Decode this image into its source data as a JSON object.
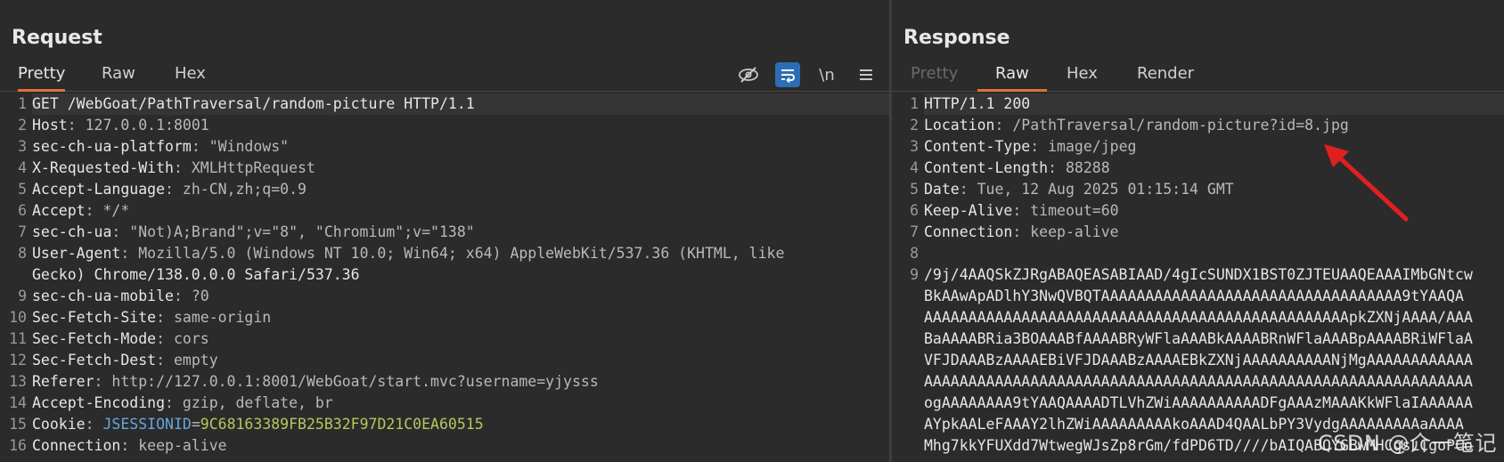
{
  "request": {
    "title": "Request",
    "tabs": [
      {
        "label": "Pretty",
        "active": true
      },
      {
        "label": "Raw",
        "active": false
      },
      {
        "label": "Hex",
        "active": false
      }
    ],
    "tools": [
      {
        "icon": "eye-off-icon"
      },
      {
        "icon": "word-wrap-icon",
        "active": true
      },
      {
        "icon": "newline-icon",
        "label": "\\n"
      },
      {
        "icon": "menu-icon"
      }
    ],
    "lines": [
      {
        "n": "1",
        "text": "GET /WebGoat/PathTraversal/random-picture HTTP/1.1"
      },
      {
        "n": "2",
        "key": "Host",
        "val": "127.0.0.1:8001"
      },
      {
        "n": "3",
        "key": "sec-ch-ua-platform",
        "val": "\"Windows\""
      },
      {
        "n": "4",
        "key": "X-Requested-With",
        "val": "XMLHttpRequest"
      },
      {
        "n": "5",
        "key": "Accept-Language",
        "val": "zh-CN,zh;q=0.9"
      },
      {
        "n": "6",
        "key": "Accept",
        "val": "*/*"
      },
      {
        "n": "7",
        "key": "sec-ch-ua",
        "val": "\"Not)A;Brand\";v=\"8\", \"Chromium\";v=\"138\""
      },
      {
        "n": "8",
        "key": "User-Agent",
        "val": "Mozilla/5.0 (Windows NT 10.0; Win64; x64) AppleWebKit/537.36 (KHTML, like"
      },
      {
        "n": "",
        "text": "Gecko) Chrome/138.0.0.0 Safari/537.36"
      },
      {
        "n": "9",
        "key": "sec-ch-ua-mobile",
        "val": "?0"
      },
      {
        "n": "10",
        "key": "Sec-Fetch-Site",
        "val": "same-origin"
      },
      {
        "n": "11",
        "key": "Sec-Fetch-Mode",
        "val": "cors"
      },
      {
        "n": "12",
        "key": "Sec-Fetch-Dest",
        "val": "empty"
      },
      {
        "n": "13",
        "key": "Referer",
        "val": "http://127.0.0.1:8001/WebGoat/start.mvc?username=yjysss"
      },
      {
        "n": "14",
        "key": "Accept-Encoding",
        "val": "gzip, deflate, br"
      },
      {
        "n": "15",
        "key": "Cookie",
        "cookie_name": "JSESSIONID",
        "cookie_value": "9C68163389FB25B32F97D21C0EA60515"
      },
      {
        "n": "16",
        "key": "Connection",
        "val": "keep-alive"
      }
    ]
  },
  "response": {
    "title": "Response",
    "tabs": [
      {
        "label": "Pretty",
        "active": false,
        "disabled": true
      },
      {
        "label": "Raw",
        "active": true
      },
      {
        "label": "Hex",
        "active": false
      },
      {
        "label": "Render",
        "active": false
      }
    ],
    "lines": [
      {
        "n": "1",
        "text": "HTTP/1.1 200"
      },
      {
        "n": "2",
        "key": "Location",
        "val": "/PathTraversal/random-picture?id=8.jpg"
      },
      {
        "n": "3",
        "key": "Content-Type",
        "val": "image/jpeg"
      },
      {
        "n": "4",
        "key": "Content-Length",
        "val": "88288"
      },
      {
        "n": "5",
        "key": "Date",
        "val": "Tue, 12 Aug 2025 01:15:14 GMT"
      },
      {
        "n": "6",
        "key": "Keep-Alive",
        "val": "timeout=60"
      },
      {
        "n": "7",
        "key": "Connection",
        "val": "keep-alive"
      },
      {
        "n": "8",
        "text": ""
      },
      {
        "n": "9",
        "text": "/9j/4AAQSkZJRgABAQEASABIAAD/4gIcSUNDX1BST0ZJTEUAAQEAAAIMbGNtcw"
      },
      {
        "n": "",
        "text": "BkAAwApADlhY3NwQVBQTAAAAAAAAAAAAAAAAAAAAAAAAAAAAAAAAAA9tYAAQA"
      },
      {
        "n": "",
        "text": "AAAAAAAAAAAAAAAAAAAAAAAAAAAAAAAAAAAAAAAAAAAAAAAApkZXNjAAAA/AAA"
      },
      {
        "n": "",
        "text": "BaAAAABRia3BOAAABfAAAABRyWFlaAAABkAAAABRnWFlaAAABpAAAABRiWFlaA"
      },
      {
        "n": "",
        "text": "VFJDAAABzAAAAEBiVFJDAAABzAAAAEBkZXNjAAAAAAAAAANjMgAAAAAAAAAAAA"
      },
      {
        "n": "",
        "text": "AAAAAAAAAAAAAAAAAAAAAAAAAAAAAAAAAAAAAAAAAAAAAAAAAAAAAAAAAAAAAA"
      },
      {
        "n": "",
        "text": "ogAAAAAAAA9tYAAQAAAADTLVhZWiAAAAAAAAAADFgAAAzMAAAKkWFlaIAAAAAA"
      },
      {
        "n": "",
        "text": "AYpkAALeFAAAY2lhZWiAAAAAAAAAkoAAAD4QAALbPY3VydgAAAAAAAAAaAAAA"
      },
      {
        "n": "",
        "text": "Mhg7kkYFUXdd7WtwegWJsZp8rGm/fdPD6TD////bAIQABQYGBwMHCgsLCgoPCo"
      }
    ]
  },
  "watermark": "CSDN @介一笔记",
  "colors": {
    "accent_tab": "#e0703a",
    "cookie_name": "#67a5e0",
    "cookie_value": "#b5c85c",
    "arrow": "#e02020"
  }
}
